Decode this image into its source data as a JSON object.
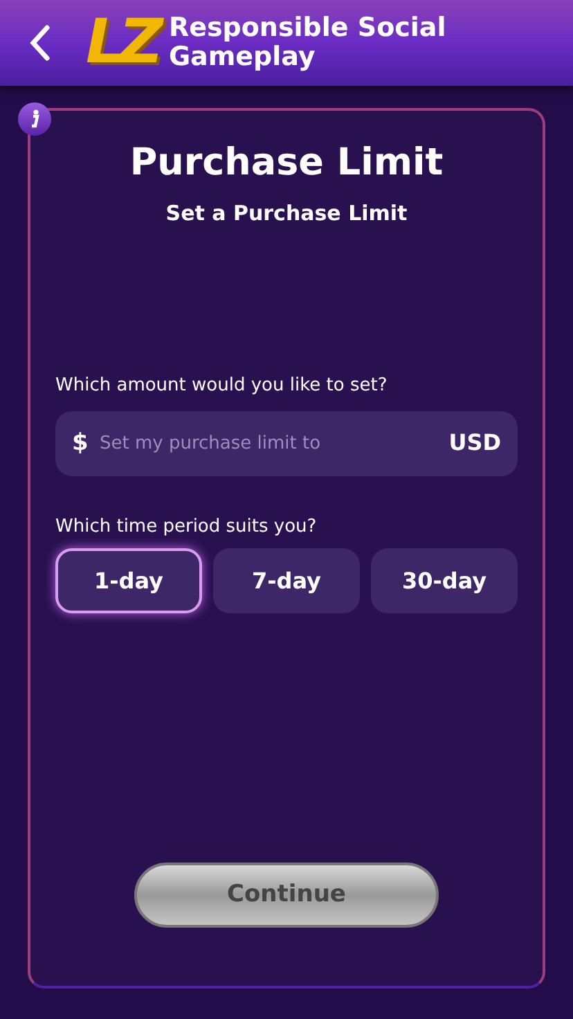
{
  "header": {
    "logo": "LZ",
    "title": "Responsible Social Gameplay"
  },
  "card": {
    "title": "Purchase Limit",
    "subtitle": "Set a Purchase Limit"
  },
  "amount": {
    "label": "Which amount would you like to set?",
    "prefix": "$",
    "placeholder": "Set my purchase limit to",
    "suffix": "USD"
  },
  "period": {
    "label": "Which time period suits you?",
    "options": [
      {
        "label": "1-day",
        "selected": true
      },
      {
        "label": "7-day",
        "selected": false
      },
      {
        "label": "30-day",
        "selected": false
      }
    ]
  },
  "continue_button": {
    "label": "Continue",
    "disabled": true
  }
}
